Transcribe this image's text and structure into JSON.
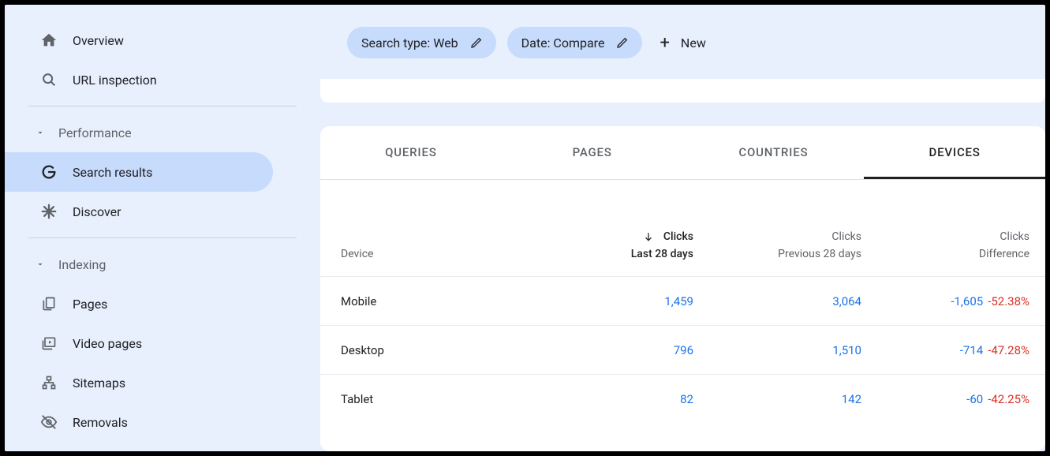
{
  "sidebar": {
    "overview": "Overview",
    "url_inspection": "URL inspection",
    "section_performance": "Performance",
    "search_results": "Search results",
    "discover": "Discover",
    "section_indexing": "Indexing",
    "pages": "Pages",
    "video_pages": "Video pages",
    "sitemaps": "Sitemaps",
    "removals": "Removals"
  },
  "filters": {
    "search_type": "Search type: Web",
    "date": "Date: Compare",
    "new_label": "New"
  },
  "tabs": {
    "queries": "QUERIES",
    "pages": "PAGES",
    "countries": "COUNTRIES",
    "devices": "DEVICES"
  },
  "table": {
    "header": {
      "device": "Device",
      "col1_top": "Clicks",
      "col1_bottom": "Last 28 days",
      "col2_top": "Clicks",
      "col2_bottom": "Previous 28 days",
      "col3_top": "Clicks",
      "col3_bottom": "Difference"
    },
    "rows": [
      {
        "device": "Mobile",
        "current": "1,459",
        "previous": "3,064",
        "diff": "-1,605",
        "pct": "-52.38%"
      },
      {
        "device": "Desktop",
        "current": "796",
        "previous": "1,510",
        "diff": "-714",
        "pct": "-47.28%"
      },
      {
        "device": "Tablet",
        "current": "82",
        "previous": "142",
        "diff": "-60",
        "pct": "-42.25%"
      }
    ]
  }
}
